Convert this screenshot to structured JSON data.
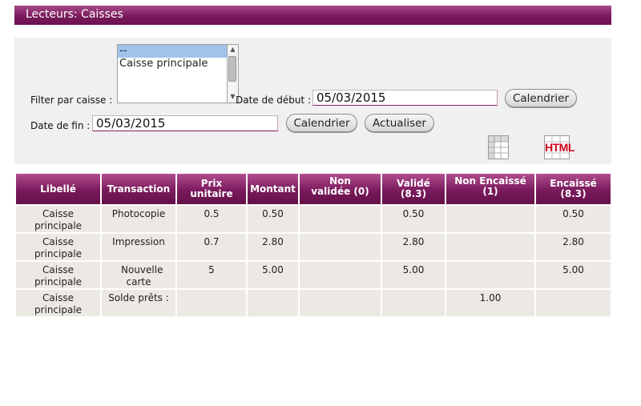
{
  "page": {
    "title": "Lecteurs: Caisses"
  },
  "filters": {
    "caisse_label": "Filter par caisse :",
    "caisse_options": [
      "--",
      "Caisse principale"
    ],
    "start_label": "Date de début :",
    "start_value": "05/03/2015",
    "end_label": "Date de fin :",
    "end_value": "05/03/2015",
    "calendar_label": "Calendrier",
    "refresh_label": "Actualiser"
  },
  "exports": {
    "spreadsheet_icon": "spreadsheet-icon",
    "html_label": "HTML"
  },
  "table": {
    "headers": [
      "Libellé",
      "Transaction",
      "Prix unitaire",
      "Montant",
      "Non validée (0)",
      "Validé (8.3)",
      "Non Encaissé (1)",
      "Encaissé (8.3)"
    ],
    "rows": [
      [
        "Caisse principale",
        "Photocopie",
        "0.5",
        "0.50",
        "",
        "0.50",
        "",
        "0.50"
      ],
      [
        "Caisse principale",
        "Impression",
        "0.7",
        "2.80",
        "",
        "2.80",
        "",
        "2.80"
      ],
      [
        "Caisse principale",
        "Nouvelle carte",
        "5",
        "5.00",
        "",
        "5.00",
        "",
        "5.00"
      ],
      [
        "Caisse principale",
        "Solde prêts :",
        "",
        "",
        "",
        "",
        "1.00",
        ""
      ]
    ]
  }
}
